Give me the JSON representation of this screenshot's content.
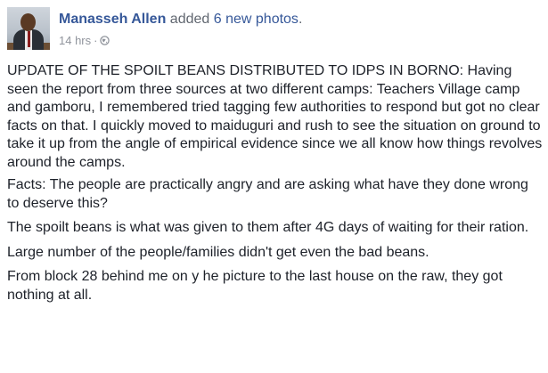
{
  "post": {
    "author": "Manasseh Allen",
    "action_prefix": "added",
    "action_count_text": "6 new photos",
    "action_suffix": ".",
    "timestamp": "14 hrs",
    "separator": "·",
    "privacy_icon": "globe-icon",
    "paragraphs": [
      "UPDATE OF THE SPOILT BEANS DISTRIBUTED TO IDPS IN BORNO: Having seen the report from three sources at two different camps: Teachers Village camp and gamboru, I remembered tried tagging few authorities to respond but got no clear facts on that. I quickly moved to maiduguri and rush to see the situation on ground to take it up from the angle of empirical evidence since we all know how things revolves around the camps.",
      "Facts: The people are practically angry and are asking what have they done wrong to deserve this?",
      "The spoilt beans is what was given to them after 4G days of waiting for their ration.",
      "Large number of the people/families didn't get even the bad beans.",
      "From block 28 behind me on y he picture to the last house on the raw, they got nothing at all."
    ]
  },
  "colors": {
    "link": "#365899",
    "text": "#1d2129",
    "meta": "#90949c"
  }
}
